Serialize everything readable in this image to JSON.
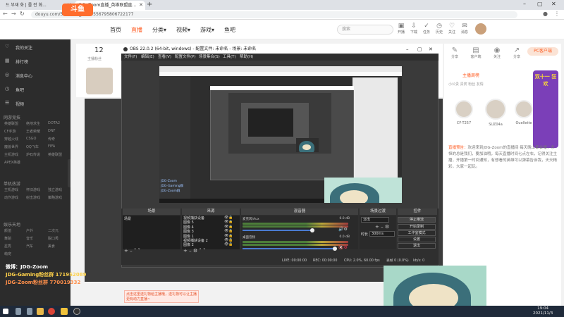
{
  "browser": {
    "tabs": [
      {
        "label": "드 부재 화 | 를 전 화...",
        "active": false
      },
      {
        "label": "JDG- Zoom直播_英雄联盟直...",
        "active": true
      }
    ],
    "url": "douyu.com/5925417_r=0.5556795806722177",
    "new_tab": "+",
    "window_controls": [
      "–",
      "▢",
      "✕"
    ]
  },
  "site": {
    "logo": "斗鱼",
    "nav": [
      "首页",
      "直播",
      "分类▾",
      "视频▾",
      "游戏▾",
      "鱼吧"
    ],
    "nav_active_index": 1,
    "search_placeholder": "搜索",
    "header_icons": [
      "开播",
      "下载",
      "任务",
      "历史",
      "关注",
      "消息"
    ],
    "accent": "#ff5d23"
  },
  "sidebar": {
    "main_items": [
      {
        "icon": "♡",
        "label": "我的关注"
      },
      {
        "icon": "▦",
        "label": "排行榜"
      },
      {
        "icon": "◎",
        "label": "消息中心"
      },
      {
        "icon": "◷",
        "label": "鱼吧"
      },
      {
        "icon": "☰",
        "label": "视频"
      }
    ],
    "sections": [
      {
        "title": "网游竞技",
        "items": [
          "英雄联盟",
          "绝地求生",
          "DOTA2",
          "CF手游",
          "王者荣耀",
          "DNF",
          "穿越火线",
          "CSGO",
          "传奇",
          "魔兽世界",
          "QQ飞车",
          "FIFA",
          "主机游戏",
          "炉石传说",
          "英雄联盟",
          "APEX英雄"
        ]
      },
      {
        "title": "单机热游",
        "items": [
          "主机游戏",
          "怀旧游戏",
          "独立游戏",
          "动作游戏",
          "射击游戏",
          "策略游戏"
        ]
      },
      {
        "title": "娱乐天地",
        "items": [
          "颜值",
          "户外",
          "二次元",
          "舞蹈",
          "音乐",
          "脱口秀",
          "星秀",
          "汽车",
          "美食",
          "萌宠"
        ]
      }
    ]
  },
  "stream_header": {
    "count": "12",
    "count_label": "主播粉丝"
  },
  "right_panel": {
    "icons": [
      "分享",
      "客户端",
      "关注",
      "分享"
    ],
    "pc_button": "PC客户端",
    "rank_title": "主播周榜",
    "rank_tabs": "小公贵   贵宾   粉丝   友情",
    "ranks": [
      {
        "name": "CF-T257"
      },
      {
        "name": "SUZ04a"
      },
      {
        "name": "Ouellette"
      }
    ],
    "promo": "双十一 狂欢",
    "announce_label": "直播预告：",
    "announce_text": "欢迎来到JDG-Zoom的直播间 每天晚上都会播，永恒的总是我们，要加油哦，每天直播时间七点左右，记得关注主播，开播第一时间通知，有想看的英雄可以弹幕告诉我，天天精彩，大家一起玩。"
  },
  "obs": {
    "title": "OBS 22.0.2 (64-bit, windows) - 配置文件: 未命名 - 场景: 未命名",
    "menu": [
      "文件(F)",
      "编辑(E)",
      "查看(V)",
      "配置文件(P)",
      "场景集合(S)",
      "工具(T)",
      "帮助(H)"
    ],
    "docks": {
      "scenes": {
        "title": "场景",
        "items": [
          "场景"
        ]
      },
      "sources": {
        "title": "来源",
        "items": [
          "视频捕获设备",
          "图像 5",
          "图像 4",
          "图像 3",
          "图像 1",
          "视频捕获设备 2",
          "图像 2"
        ]
      },
      "mixer": {
        "title": "混音器",
        "rows": [
          {
            "name": "麦克风/Aux",
            "level": "0.0 dB"
          },
          {
            "name": "桌面音频",
            "level": "0.0 dB"
          }
        ]
      },
      "transitions": {
        "title": "场景过渡",
        "selected": "淡出",
        "duration_label": "时长",
        "duration": "300ms"
      },
      "controls": {
        "title": "控件",
        "buttons": [
          "停止推流",
          "开始录制",
          "工作室模式",
          "设置",
          "退出"
        ]
      }
    },
    "status": {
      "live": "LIVE: 00:00:00",
      "rec": "REC: 00:00:00",
      "cpu": "CPU: 2.0%, 60.00 fps",
      "dropped": "丢帧 0 (0.0%)",
      "kbps": "kb/s: 0"
    }
  },
  "chat_overlay": {
    "nested_lines": [
      "JDG-Zoom",
      "JDG-Gaming群",
      "JDG-Zoom群"
    ]
  },
  "caster": {
    "lines": [
      "微博：JDG-Zoom",
      "JDG-Gaming粉丝群  171952089",
      "JDG-Zoom粉丝群  770019332"
    ]
  },
  "gift_tip": "点击这里送礼物给主播哦，送礼物可以让主播更有动力直播~",
  "taskbar": {
    "time": "19:04",
    "date": "2021/11/3"
  }
}
